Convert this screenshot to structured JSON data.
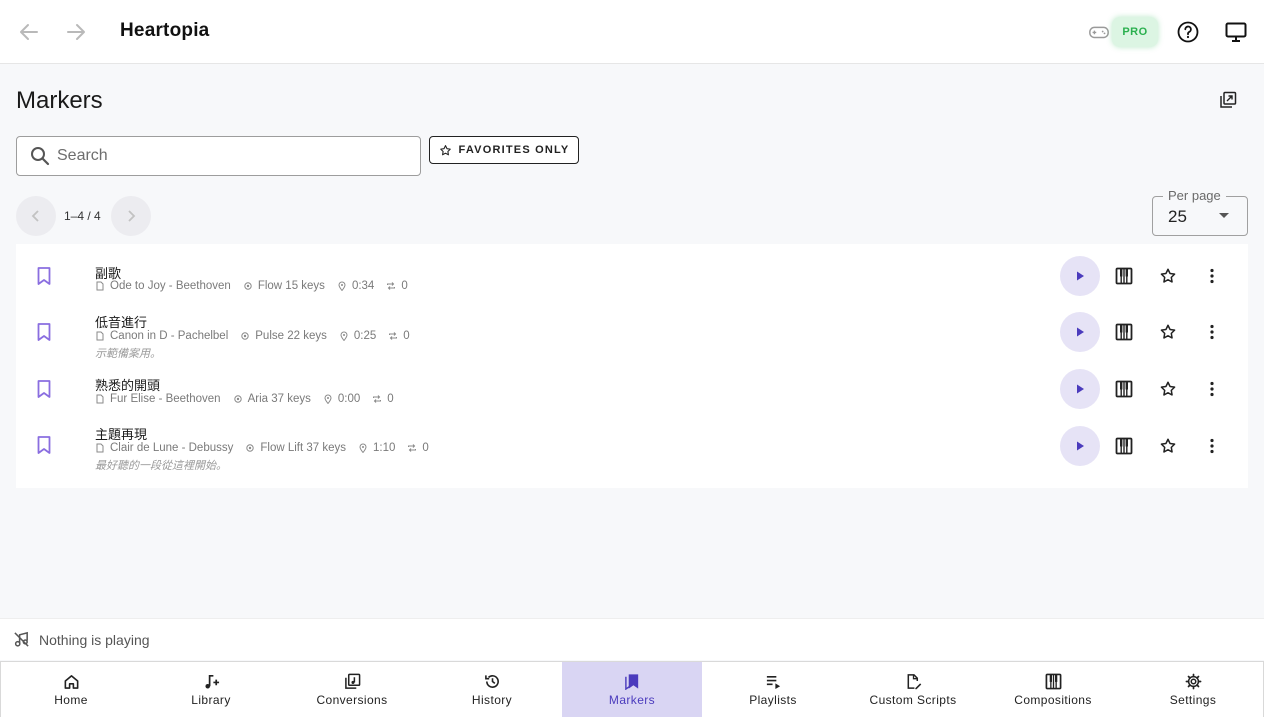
{
  "app": {
    "title": "Heartopia",
    "pro_badge": "PRO"
  },
  "page": {
    "title": "Markers"
  },
  "search": {
    "placeholder": "Search",
    "value": ""
  },
  "filters": {
    "favorites_label": "FAVORITES ONLY"
  },
  "pagination": {
    "label": "1–4 / 4",
    "per_page_label": "Per page",
    "per_page_value": "25"
  },
  "markers": [
    {
      "title": "副歌",
      "song": "Ode to Joy - Beethoven",
      "preset": "Flow 15 keys",
      "time": "0:34",
      "loops": "0",
      "note": ""
    },
    {
      "title": "低音進行",
      "song": "Canon in D - Pachelbel",
      "preset": "Pulse 22 keys",
      "time": "0:25",
      "loops": "0",
      "note": "示範備案用。"
    },
    {
      "title": "熟悉的開頭",
      "song": "Fur Elise - Beethoven",
      "preset": "Aria 37 keys",
      "time": "0:00",
      "loops": "0",
      "note": ""
    },
    {
      "title": "主題再現",
      "song": "Clair de Lune - Debussy",
      "preset": "Flow Lift 37 keys",
      "time": "1:10",
      "loops": "0",
      "note": "最好聽的一段從這裡開始。"
    }
  ],
  "now_playing": {
    "text": "Nothing is playing"
  },
  "bottom_nav": [
    {
      "label": "Home",
      "icon": "home-icon"
    },
    {
      "label": "Library",
      "icon": "music-note-plus-icon"
    },
    {
      "label": "Conversions",
      "icon": "convert-icon"
    },
    {
      "label": "History",
      "icon": "history-icon"
    },
    {
      "label": "Markers",
      "icon": "bookmarks-icon",
      "active": true
    },
    {
      "label": "Playlists",
      "icon": "playlist-play-icon"
    },
    {
      "label": "Custom Scripts",
      "icon": "script-edit-icon"
    },
    {
      "label": "Compositions",
      "icon": "piano-icon"
    },
    {
      "label": "Settings",
      "icon": "gear-icon"
    }
  ],
  "colors": {
    "accent": "#4b3bbd",
    "accent_soft": "#e6e3f6",
    "active_tab": "#d9d5f3",
    "pro_green": "#2bb04f",
    "bookmark": "#8a6ee0"
  }
}
